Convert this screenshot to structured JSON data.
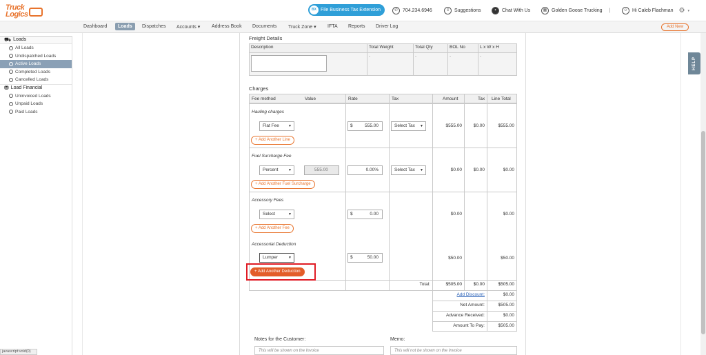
{
  "brand": {
    "line1": "Truck",
    "line2": "Logics"
  },
  "topbar": {
    "tax_button": "File Business Tax Extension",
    "tax_badge": "BX",
    "phone": "704.234.6946",
    "suggestions": "Suggestions",
    "chat": "Chat With Us",
    "company": "Golden Goose Trucking",
    "separator": "|",
    "user": "Hi Caleb Flachman"
  },
  "nav": {
    "items": [
      "Dashboard",
      "Loads",
      "Dispatches",
      "Accounts ▾",
      "Address Book",
      "Documents",
      "Truck Zone ▾",
      "IFTA",
      "Reports",
      "Driver Log"
    ],
    "add_new": "Add New"
  },
  "sidebar": {
    "loads_header": "Loads",
    "loads_items": [
      "All Loads",
      "Undispatched Loads",
      "Active Loads",
      "Completed Loads",
      "Cancelled Loads"
    ],
    "financial_header": "Load Financial",
    "financial_items": [
      "Uninvoiced Loads",
      "Unpaid Loads",
      "Paid Loads"
    ]
  },
  "freight": {
    "title": "Freight Details",
    "columns": [
      "Description",
      "Total Weight",
      "Total Qty",
      "BOL No",
      "L x W x H"
    ],
    "row": [
      "-",
      "-",
      "-",
      "-"
    ]
  },
  "charges": {
    "title": "Charges",
    "columns": [
      "Fee method",
      "Value",
      "Rate",
      "Tax",
      "Amount",
      "Tax",
      "Line Total"
    ],
    "hauling": {
      "label": "Hauling charges",
      "method": "Flat Fee",
      "currency": "$",
      "rate": "555.00",
      "tax": "Select Tax",
      "amount": "$555.00",
      "tax_amt": "$0.00",
      "total": "$555.00",
      "add": "Add Another Line"
    },
    "fuel": {
      "label": "Fuel Surcharge Fee",
      "method": "Percent",
      "value": "555.00",
      "rate": "0.00",
      "rate_unit": "%",
      "tax": "Select Tax",
      "amount": "$0.00",
      "tax_amt": "$0.00",
      "total": "$0.00",
      "add": "Add Another Fuel Surcharge"
    },
    "accessory": {
      "label": "Accessory Fees",
      "method": "Select",
      "currency": "$",
      "rate": "0.00",
      "amount": "$0.00",
      "total": "$0.00",
      "add": "Add Another Fee"
    },
    "deduction": {
      "label": "Accessorial Deduction",
      "method": "Lumper",
      "currency": "$",
      "rate": "50.00",
      "amount": "$50.00",
      "total": "$50.00",
      "add": "Add Another Deduction"
    },
    "totals": {
      "label": "Total:",
      "amount": "$505.00",
      "tax": "$0.00",
      "line": "$505.00"
    },
    "summary": [
      {
        "label": "Add Discount:",
        "value": "$0.00"
      },
      {
        "label": "Net Amount:",
        "value": "$505.00"
      },
      {
        "label": "Advance Received:",
        "value": "$0.00"
      },
      {
        "label": "Amount To Pay:",
        "value": "$505.00"
      }
    ]
  },
  "notes": {
    "customer_label": "Notes for the Customer:",
    "customer_placeholder": "This will be shown on the Invoice",
    "memo_label": "Memo:",
    "memo_placeholder": "This will not be shown on the Invoice"
  },
  "help": "HELP",
  "status_bar": "javascript:void(0)",
  "colors": {
    "accent": "#e8732c",
    "nav_active": "#8a9eb0",
    "tax_button": "#2f9fd8",
    "highlight": "#e01b24"
  }
}
